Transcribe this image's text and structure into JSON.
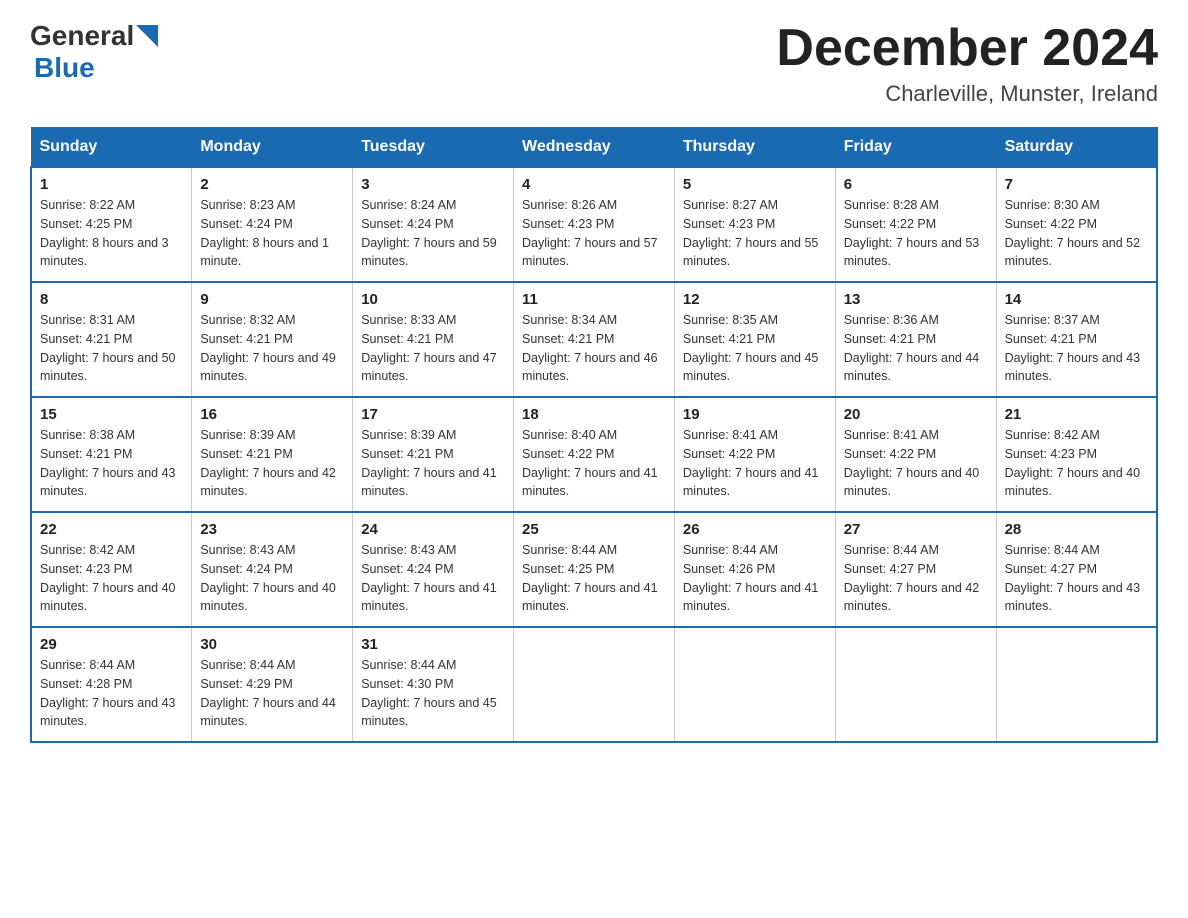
{
  "header": {
    "logo_general": "General",
    "logo_blue": "Blue",
    "month_title": "December 2024",
    "subtitle": "Charleville, Munster, Ireland"
  },
  "days_of_week": [
    "Sunday",
    "Monday",
    "Tuesday",
    "Wednesday",
    "Thursday",
    "Friday",
    "Saturday"
  ],
  "weeks": [
    [
      {
        "day": "1",
        "sunrise": "8:22 AM",
        "sunset": "4:25 PM",
        "daylight": "8 hours and 3 minutes."
      },
      {
        "day": "2",
        "sunrise": "8:23 AM",
        "sunset": "4:24 PM",
        "daylight": "8 hours and 1 minute."
      },
      {
        "day": "3",
        "sunrise": "8:24 AM",
        "sunset": "4:24 PM",
        "daylight": "7 hours and 59 minutes."
      },
      {
        "day": "4",
        "sunrise": "8:26 AM",
        "sunset": "4:23 PM",
        "daylight": "7 hours and 57 minutes."
      },
      {
        "day": "5",
        "sunrise": "8:27 AM",
        "sunset": "4:23 PM",
        "daylight": "7 hours and 55 minutes."
      },
      {
        "day": "6",
        "sunrise": "8:28 AM",
        "sunset": "4:22 PM",
        "daylight": "7 hours and 53 minutes."
      },
      {
        "day": "7",
        "sunrise": "8:30 AM",
        "sunset": "4:22 PM",
        "daylight": "7 hours and 52 minutes."
      }
    ],
    [
      {
        "day": "8",
        "sunrise": "8:31 AM",
        "sunset": "4:21 PM",
        "daylight": "7 hours and 50 minutes."
      },
      {
        "day": "9",
        "sunrise": "8:32 AM",
        "sunset": "4:21 PM",
        "daylight": "7 hours and 49 minutes."
      },
      {
        "day": "10",
        "sunrise": "8:33 AM",
        "sunset": "4:21 PM",
        "daylight": "7 hours and 47 minutes."
      },
      {
        "day": "11",
        "sunrise": "8:34 AM",
        "sunset": "4:21 PM",
        "daylight": "7 hours and 46 minutes."
      },
      {
        "day": "12",
        "sunrise": "8:35 AM",
        "sunset": "4:21 PM",
        "daylight": "7 hours and 45 minutes."
      },
      {
        "day": "13",
        "sunrise": "8:36 AM",
        "sunset": "4:21 PM",
        "daylight": "7 hours and 44 minutes."
      },
      {
        "day": "14",
        "sunrise": "8:37 AM",
        "sunset": "4:21 PM",
        "daylight": "7 hours and 43 minutes."
      }
    ],
    [
      {
        "day": "15",
        "sunrise": "8:38 AM",
        "sunset": "4:21 PM",
        "daylight": "7 hours and 43 minutes."
      },
      {
        "day": "16",
        "sunrise": "8:39 AM",
        "sunset": "4:21 PM",
        "daylight": "7 hours and 42 minutes."
      },
      {
        "day": "17",
        "sunrise": "8:39 AM",
        "sunset": "4:21 PM",
        "daylight": "7 hours and 41 minutes."
      },
      {
        "day": "18",
        "sunrise": "8:40 AM",
        "sunset": "4:22 PM",
        "daylight": "7 hours and 41 minutes."
      },
      {
        "day": "19",
        "sunrise": "8:41 AM",
        "sunset": "4:22 PM",
        "daylight": "7 hours and 41 minutes."
      },
      {
        "day": "20",
        "sunrise": "8:41 AM",
        "sunset": "4:22 PM",
        "daylight": "7 hours and 40 minutes."
      },
      {
        "day": "21",
        "sunrise": "8:42 AM",
        "sunset": "4:23 PM",
        "daylight": "7 hours and 40 minutes."
      }
    ],
    [
      {
        "day": "22",
        "sunrise": "8:42 AM",
        "sunset": "4:23 PM",
        "daylight": "7 hours and 40 minutes."
      },
      {
        "day": "23",
        "sunrise": "8:43 AM",
        "sunset": "4:24 PM",
        "daylight": "7 hours and 40 minutes."
      },
      {
        "day": "24",
        "sunrise": "8:43 AM",
        "sunset": "4:24 PM",
        "daylight": "7 hours and 41 minutes."
      },
      {
        "day": "25",
        "sunrise": "8:44 AM",
        "sunset": "4:25 PM",
        "daylight": "7 hours and 41 minutes."
      },
      {
        "day": "26",
        "sunrise": "8:44 AM",
        "sunset": "4:26 PM",
        "daylight": "7 hours and 41 minutes."
      },
      {
        "day": "27",
        "sunrise": "8:44 AM",
        "sunset": "4:27 PM",
        "daylight": "7 hours and 42 minutes."
      },
      {
        "day": "28",
        "sunrise": "8:44 AM",
        "sunset": "4:27 PM",
        "daylight": "7 hours and 43 minutes."
      }
    ],
    [
      {
        "day": "29",
        "sunrise": "8:44 AM",
        "sunset": "4:28 PM",
        "daylight": "7 hours and 43 minutes."
      },
      {
        "day": "30",
        "sunrise": "8:44 AM",
        "sunset": "4:29 PM",
        "daylight": "7 hours and 44 minutes."
      },
      {
        "day": "31",
        "sunrise": "8:44 AM",
        "sunset": "4:30 PM",
        "daylight": "7 hours and 45 minutes."
      },
      null,
      null,
      null,
      null
    ]
  ]
}
